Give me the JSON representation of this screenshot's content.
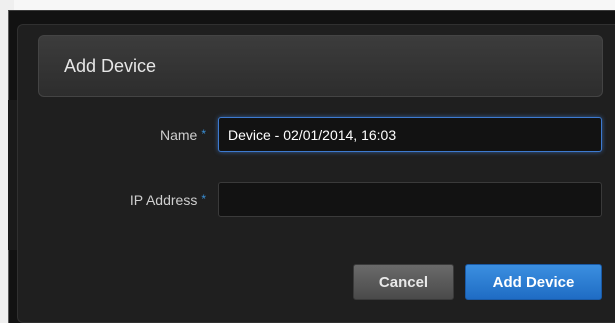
{
  "dialog": {
    "title": "Add Device",
    "fields": {
      "name": {
        "label": "Name",
        "required_marker": "*",
        "value": "Device - 02/01/2014, 16:03"
      },
      "ip_address": {
        "label": "IP Address",
        "required_marker": "*",
        "value": ""
      }
    },
    "buttons": {
      "cancel": "Cancel",
      "submit": "Add Device"
    }
  },
  "colors": {
    "accent": "#2b7fd6",
    "required_marker": "#3a8fd6",
    "background": "#1f1f1f"
  }
}
